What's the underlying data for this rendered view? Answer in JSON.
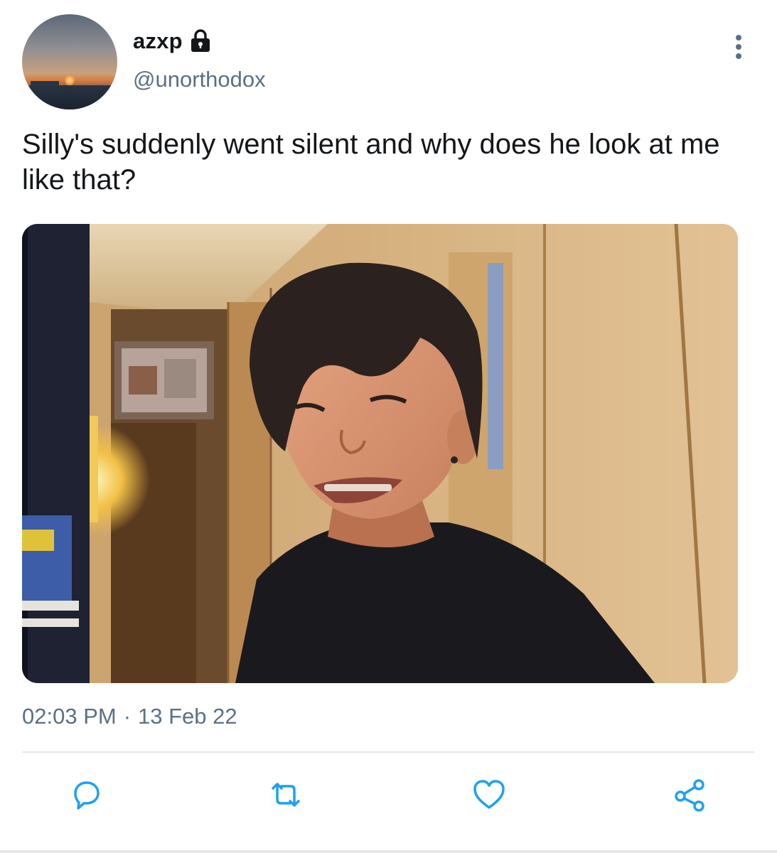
{
  "user": {
    "display_name": "azxp",
    "handle": "@unorthodox",
    "protected": true
  },
  "tweet": {
    "text": "Silly's suddenly went silent and why does he look at me like that?",
    "time": "02:03 PM",
    "separator": "·",
    "date": "13 Feb 22"
  },
  "icons": {
    "lock": "lock-icon",
    "more": "more-vertical-icon",
    "reply": "reply-icon",
    "retweet": "retweet-icon",
    "like": "like-icon",
    "share": "share-icon"
  },
  "colors": {
    "text": "#14171a",
    "secondary": "#5b7083",
    "icon": "#1da1f2",
    "divider": "#e1e8ed"
  }
}
